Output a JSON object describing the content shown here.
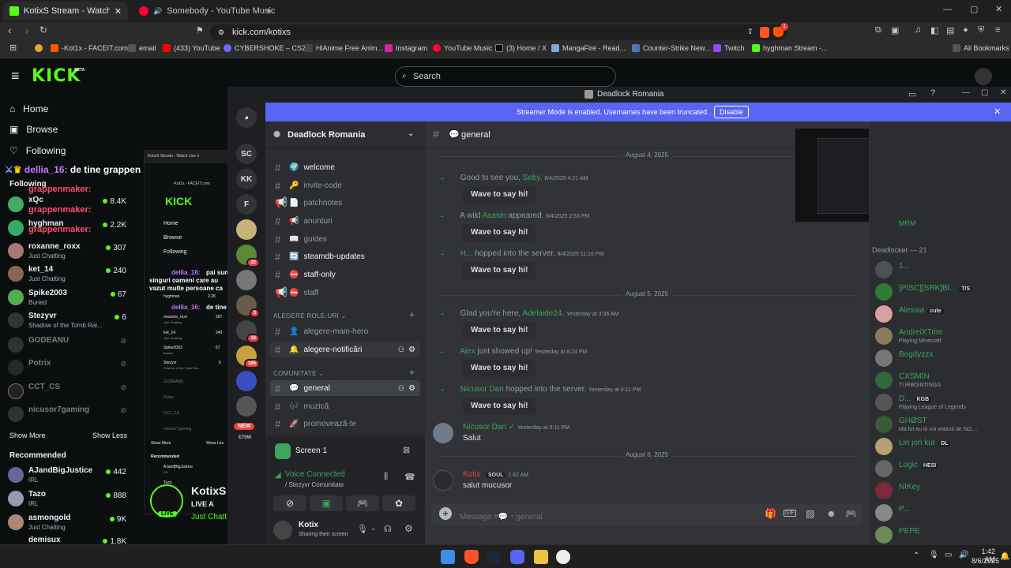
{
  "browser": {
    "tabs": [
      {
        "title": "KotixS Stream - Watch Live o",
        "active": true
      },
      {
        "title": "Somebody - YouTube Music",
        "active": false
      }
    ],
    "new_tab": "+",
    "url": "kick.com/kotixs",
    "bookmarks": [
      "-Kot1x - FACEIT.com",
      "email",
      "(433) YouTube",
      "CYBERSHOKE – CS2...",
      "HiAnime Free Anim...",
      "Instagram",
      "YouTube Music",
      "(3) Home / X",
      "MangaFire - Read...",
      "Counter-Strike New...",
      "Twitch",
      "hyghman Stream -..."
    ],
    "all_bookmarks": "All Bookmarks",
    "badge_count": "1"
  },
  "kick": {
    "logo": "KICK",
    "logo_badge": "BETA",
    "search_placeholder": "Search",
    "nav": {
      "home": "Home",
      "browse": "Browse",
      "following": "Following"
    },
    "following_header": "Following",
    "overlay_chat": {
      "user1": "dellia_16:",
      "msg1": "de tine grappen",
      "user2": "grappenmaker:",
      "user3": "grappenmaker:",
      "user4": "grappenmaker:"
    },
    "following": [
      {
        "name": "xQc",
        "sub": "",
        "count": "8.4K",
        "live": true
      },
      {
        "name": "hyghman",
        "sub": "",
        "count": "2.2K",
        "live": true
      },
      {
        "name": "roxanne_roxx",
        "sub": "Just Chatting",
        "count": "307",
        "live": true
      },
      {
        "name": "ket_14",
        "sub": "Just Chatting",
        "count": "240",
        "live": true
      },
      {
        "name": "Spike2003",
        "sub": "Buried",
        "count": "67",
        "live": true
      },
      {
        "name": "Stezyvr",
        "sub": "Shadow of the Tomb Rai...",
        "count": "6",
        "live": true
      },
      {
        "name": "GODEANU",
        "sub": "",
        "count": "",
        "live": false
      },
      {
        "name": "Potrix",
        "sub": "",
        "count": "",
        "live": false
      },
      {
        "name": "CCT_CS",
        "sub": "",
        "count": "",
        "live": false
      },
      {
        "name": "nicusor7gaming",
        "sub": "",
        "count": "",
        "live": false
      }
    ],
    "show_more": "Show More",
    "show_less": "Show Less",
    "recommended_header": "Recommended",
    "recommended": [
      {
        "name": "AJandBigJustice",
        "sub": "IRL",
        "count": "442"
      },
      {
        "name": "Tazo",
        "sub": "IRL",
        "count": "888"
      },
      {
        "name": "asmongold",
        "sub": "Just Chatting",
        "count": "9K"
      },
      {
        "name": "demisux",
        "sub": "",
        "count": "1.8K"
      }
    ],
    "stream": {
      "name": "KotixS",
      "live_label": "LIVE A",
      "category": "Just Chatt",
      "avatar_badge": "LIVE"
    },
    "mini": {
      "title": "KotixS Stream - Watch Live o",
      "url": "-Kot1x - FACEIT.com",
      "logo": "KICK",
      "home": "Home",
      "browse": "Browse",
      "following": "Following",
      "chat_user": "dellia_16:",
      "chat_msg": "pai sun",
      "chat_line2": "singuri oameni care au",
      "chat_line3": "vazut multe persoane ca",
      "chat_user2": "dellia_16:",
      "chat_msg2": "de tine",
      "rows": [
        {
          "name": "hyghman",
          "count": "2.2K"
        },
        {
          "name": "roxanne_roxx",
          "sub": "Just Chatting",
          "count": "307"
        },
        {
          "name": "ket_14",
          "sub": "Just Chatting",
          "count": "240"
        },
        {
          "name": "Spike2003",
          "sub": "Buried",
          "count": "67"
        },
        {
          "name": "Stezyvr",
          "sub": "Shadow of the Tomb Rai...",
          "count": "6"
        },
        {
          "name": "GODEANU"
        },
        {
          "name": "Potrix"
        },
        {
          "name": "CCT_CS"
        },
        {
          "name": "nicusor7gaming"
        }
      ],
      "show_more": "Show More",
      "show_less": "Show Les",
      "recommended": "Recommended",
      "rec": [
        {
          "name": "AJandBigJustice",
          "sub": "IRL"
        },
        {
          "name": "Tazo",
          "sub": "IRL"
        },
        {
          "name": "asmongold",
          "sub": "Just Chatting"
        },
        {
          "name": "demisux"
        }
      ]
    }
  },
  "discord": {
    "window_title": "Deadlock Romania",
    "streamer_banner": "Streamer Mode is enabled. Usernames have been truncated.",
    "disable": "Disable",
    "guilds": [
      {
        "label": "SC",
        "badge": ""
      },
      {
        "label": "KK",
        "badge": ""
      },
      {
        "label": "F",
        "badge": ""
      },
      {
        "label": "",
        "badge": ""
      },
      {
        "label": "",
        "badge": "22"
      },
      {
        "label": "",
        "badge": ""
      },
      {
        "label": "",
        "badge": "3"
      },
      {
        "label": "",
        "badge": "16"
      },
      {
        "label": "",
        "badge": "195"
      },
      {
        "label": "",
        "badge": ""
      },
      {
        "label": "",
        "badge": ""
      }
    ],
    "new_label": "NEW",
    "more_label": "E70W",
    "server_name": "Deadlock Romania",
    "channels_top": [
      {
        "name": "welcome",
        "emoji": "🌍",
        "unread": true
      },
      {
        "name": "invite-code",
        "emoji": "🔑",
        "unread": false
      },
      {
        "name": "patchnotes",
        "emoji": "📄",
        "unread": false
      },
      {
        "name": "anunțuri",
        "emoji": "📢",
        "unread": false
      },
      {
        "name": "guides",
        "emoji": "📖",
        "unread": false
      },
      {
        "name": "steamdb-updates",
        "emoji": "🔄",
        "unread": true
      },
      {
        "name": "staff-only",
        "emoji": "⛔",
        "unread": true
      },
      {
        "name": "staff",
        "emoji": "⛔",
        "unread": false
      }
    ],
    "category_roles": "ALEGERE ROLE-URI",
    "channels_roles": [
      {
        "name": "alegere-main-hero",
        "emoji": "👤",
        "unread": false
      },
      {
        "name": "alegere-notificări",
        "emoji": "🔔",
        "unread": true
      }
    ],
    "category_community": "COMUNITATE",
    "channels_community": [
      {
        "name": "general",
        "emoji": "💬",
        "selected": true
      },
      {
        "name": "muzică",
        "emoji": "🎶",
        "selected": false
      },
      {
        "name": "promovează-te",
        "emoji": "🚀",
        "selected": false
      }
    ],
    "screen_share": "Screen 1",
    "voice_connected": "Voice Connected",
    "voice_channel": "/ Stezyvr Comunitate",
    "user_name": "Kotix",
    "user_status": "Sharing their screen",
    "chat_channel": "general",
    "messages": [
      {
        "type": "divider",
        "text": "August 4, 2025"
      },
      {
        "type": "join",
        "pre": "Good to see you, ",
        "user": "Seby",
        "post": ".",
        "time": "8/4/2025 4:21 AM",
        "button": "Wave to say hi!"
      },
      {
        "type": "join",
        "pre": "A wild ",
        "user": "Asasin",
        "post": " appeared.",
        "time": "8/4/2025 2:53 PM",
        "button": "Wave to say hi!"
      },
      {
        "type": "join",
        "pre": "",
        "user": "H...",
        "post": " hopped into the server.",
        "time": "8/4/2025 11:16 PM",
        "button": "Wave to say hi!"
      },
      {
        "type": "divider",
        "text": "August 5, 2025"
      },
      {
        "type": "join",
        "pre": "Glad you're here, ",
        "user": "Adelaide24",
        "post": ".",
        "time": "Yesterday at 3:36 AM",
        "button": "Wave to say hi!"
      },
      {
        "type": "join",
        "pre": "",
        "user": "Alex",
        "post": " just showed up!",
        "time": "Yesterday at 8:24 PM",
        "button": "Wave to say hi!"
      },
      {
        "type": "join",
        "pre": "",
        "user": "Nicusor Dan",
        "post": " hopped into the server.",
        "time": "Yesterday at 9:11 PM",
        "button": "Wave to say hi!"
      },
      {
        "type": "message",
        "user": "Nicusor Dan",
        "time": "Yesterday at 9:11 PM",
        "text": "Salut"
      },
      {
        "type": "divider",
        "text": "August 6, 2025"
      },
      {
        "type": "message",
        "user": "Kotix",
        "tag": "SOUL",
        "time": "1:42 AM",
        "text": "salut mucusor"
      }
    ],
    "message_placeholder": "Message #💬・general",
    "members_header": "Deadlocker — 21",
    "top_member": "MRM",
    "members": [
      {
        "name": "1...",
        "status": "",
        "tag": ""
      },
      {
        "name": "[PISC][SRK]Bl...",
        "status": "",
        "tag": "T/S"
      },
      {
        "name": "Alessia",
        "status": "",
        "tag": "cute"
      },
      {
        "name": "AndreiXTrim",
        "status": "Playing Minecraft",
        "tag": ""
      },
      {
        "name": "Bogdyzzx",
        "status": "",
        "tag": ""
      },
      {
        "name": "CXSMIN",
        "status": "TURBOINTINGG",
        "tag": ""
      },
      {
        "name": "D...",
        "status": "Playing League of Legends",
        "tag": "KGB"
      },
      {
        "name": "GHØST",
        "status": "Ma fut eu in voi votanti de ND,...",
        "tag": ""
      },
      {
        "name": "Lin jon kur",
        "status": "",
        "tag": "DL"
      },
      {
        "name": "Logic",
        "status": "",
        "tag": "HESI"
      },
      {
        "name": "NIKey",
        "status": "",
        "tag": ""
      },
      {
        "name": "P...",
        "status": "",
        "tag": ""
      },
      {
        "name": "PEPE",
        "status": "",
        "tag": ""
      }
    ]
  },
  "taskbar": {
    "time": "1:42 AM",
    "date": "8/6/2025"
  }
}
